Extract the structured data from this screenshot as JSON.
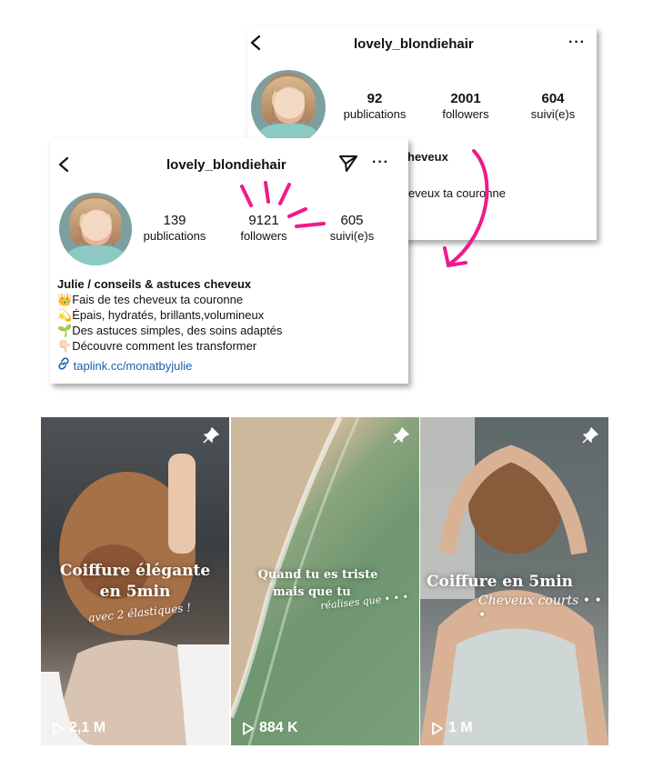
{
  "back_profile": {
    "username": "lovely_blondiehair",
    "stats": [
      {
        "value": "92",
        "label": "publications"
      },
      {
        "value": "2001",
        "label": "followers"
      },
      {
        "value": "604",
        "label": "suivi(e)s"
      }
    ],
    "bio_fragments": [
      "heveux",
      "eveux ta couronne"
    ]
  },
  "front_profile": {
    "username": "lovely_blondiehair",
    "stats": [
      {
        "value": "139",
        "label": "publications"
      },
      {
        "value": "9121",
        "label": "followers"
      },
      {
        "value": "605",
        "label": "suivi(e)s"
      }
    ],
    "bio": {
      "name": "Julie / conseils & astuces cheveux",
      "lines": [
        {
          "emoji": "👑",
          "text": "Fais de tes cheveux ta couronne"
        },
        {
          "emoji": "💫",
          "text": "Épais, hydratés, brillants,volumineux"
        },
        {
          "emoji": "🌱",
          "text": "Des astuces simples, des soins adaptés"
        },
        {
          "emoji": "👇🏻",
          "text": "Découvre comment les transformer"
        }
      ],
      "link": "taplink.cc/monatbyjulie"
    }
  },
  "reels": [
    {
      "title_lines": [
        "Coiffure élégante",
        "en 5min"
      ],
      "script": "avec 2 élastiques !",
      "views": "2,1 M"
    },
    {
      "title_lines": [
        "Quand tu es triste",
        "mais que tu"
      ],
      "script": "réalises que • • •",
      "views": "884 K"
    },
    {
      "title_lines": [
        "Coiffure en 5min"
      ],
      "script": "Cheveux courts • • •",
      "views": "1 M"
    }
  ],
  "colors": {
    "accent_arrow": "#ee1b8b",
    "link": "#1f5eb0"
  }
}
